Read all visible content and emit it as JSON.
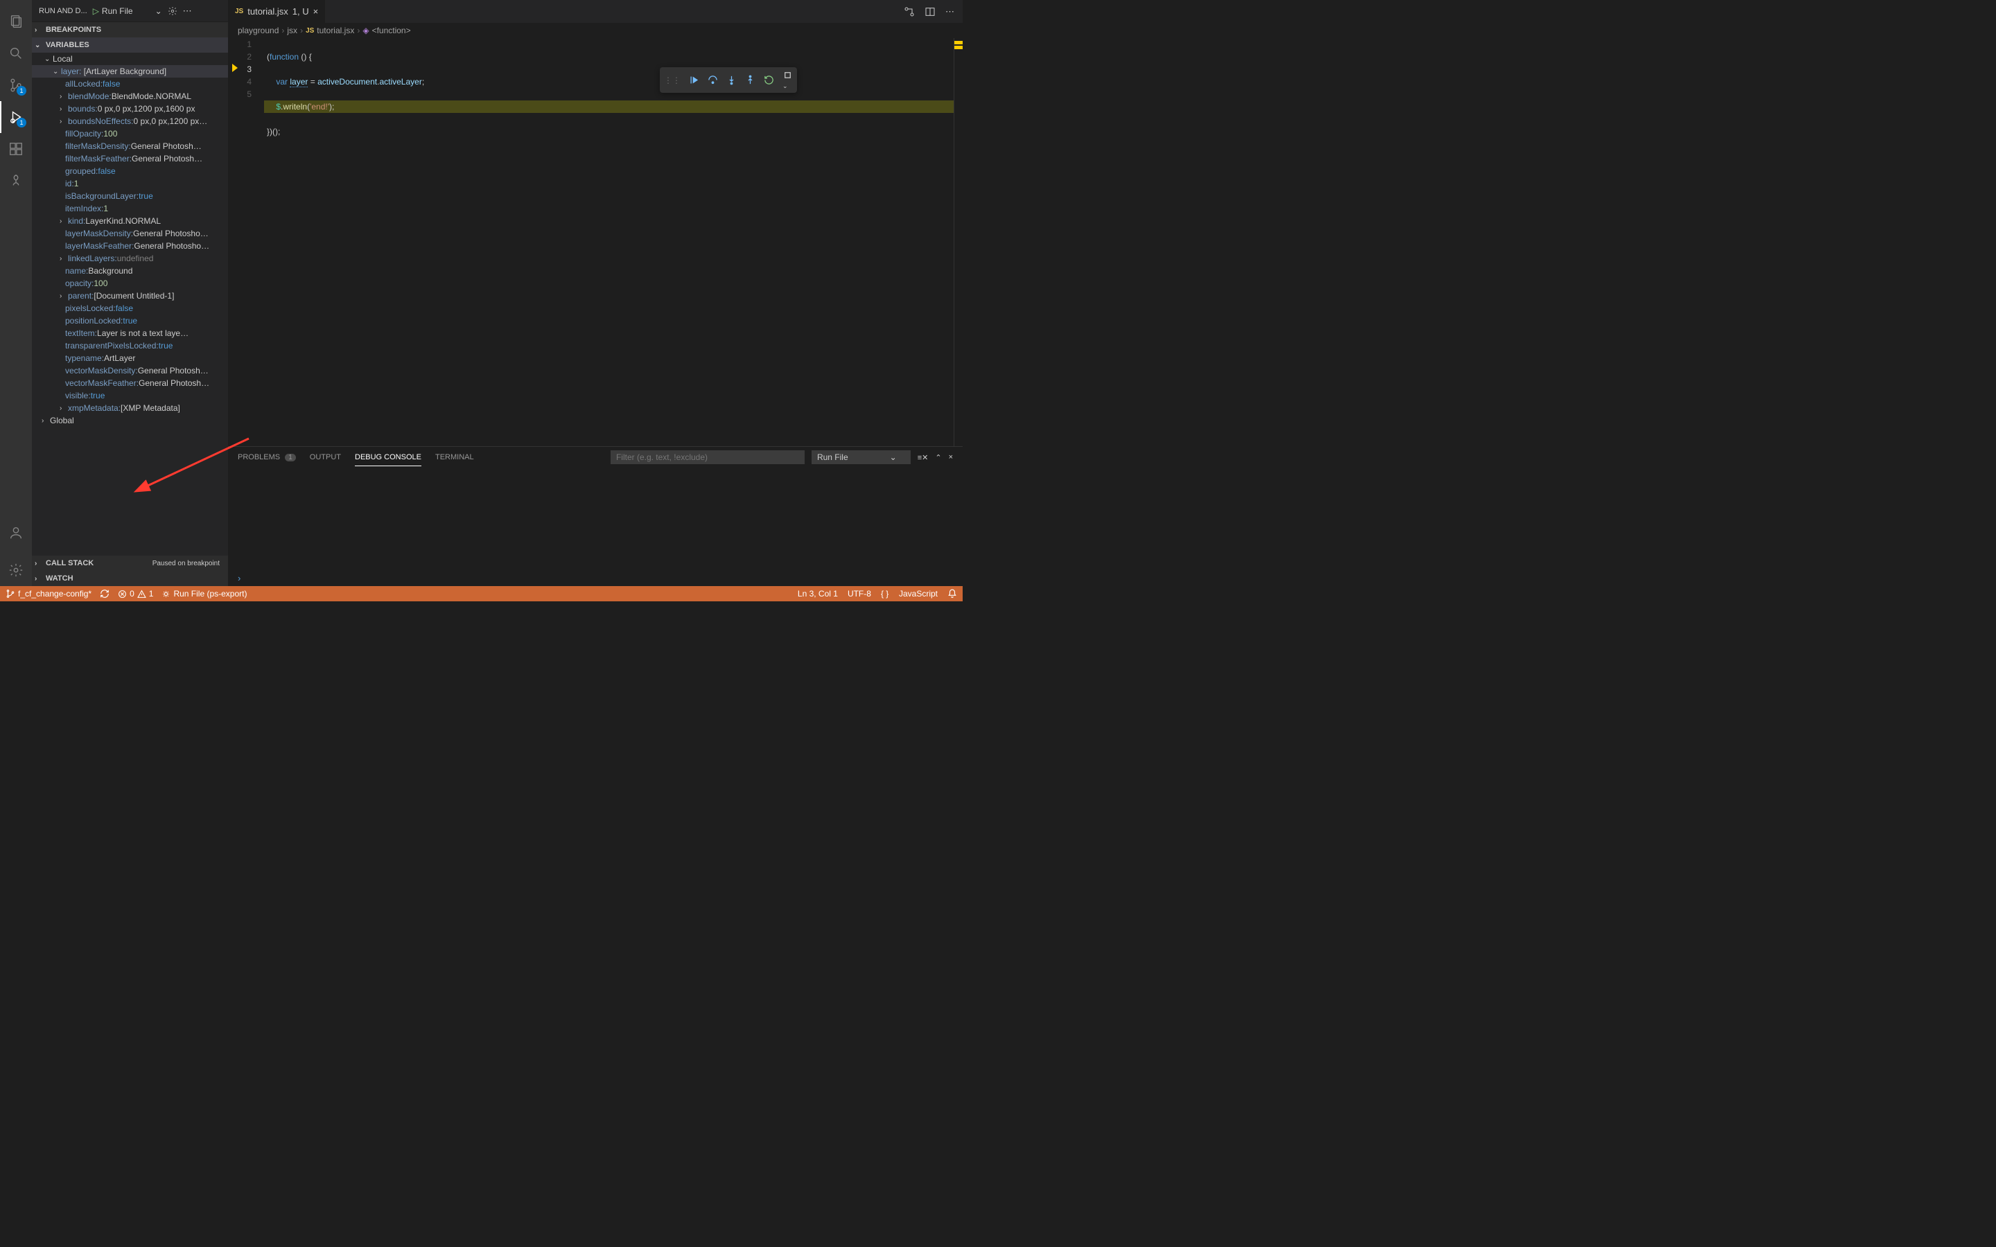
{
  "activity_bar": {
    "scm_badge": "1",
    "debug_badge": "1"
  },
  "sidebar": {
    "title": "RUN AND D...",
    "run_label": "Run File",
    "sections": {
      "breakpoints": "BREAKPOINTS",
      "variables": "VARIABLES",
      "call_stack": "CALL STACK",
      "call_stack_status": "Paused on breakpoint",
      "watch": "WATCH"
    },
    "scopes": {
      "local": "Local",
      "global": "Global"
    },
    "layer_label": "layer:",
    "layer_value": "[ArtLayer Background]",
    "props": [
      {
        "k": "allLocked",
        "v": "false",
        "t": "bool",
        "exp": false
      },
      {
        "k": "blendMode",
        "v": "BlendMode.NORMAL",
        "t": "plain",
        "exp": true
      },
      {
        "k": "bounds",
        "v": "0 px,0 px,1200 px,1600 px",
        "t": "plain",
        "exp": true
      },
      {
        "k": "boundsNoEffects",
        "v": "0 px,0 px,1200 px…",
        "t": "plain",
        "exp": true
      },
      {
        "k": "fillOpacity",
        "v": "100",
        "t": "num",
        "exp": false
      },
      {
        "k": "filterMaskDensity",
        "v": "General Photosh…",
        "t": "plain",
        "exp": false
      },
      {
        "k": "filterMaskFeather",
        "v": "General Photosh…",
        "t": "plain",
        "exp": false
      },
      {
        "k": "grouped",
        "v": "false",
        "t": "bool",
        "exp": false
      },
      {
        "k": "id",
        "v": "1",
        "t": "num",
        "exp": false
      },
      {
        "k": "isBackgroundLayer",
        "v": "true",
        "t": "bool",
        "exp": false
      },
      {
        "k": "itemIndex",
        "v": "1",
        "t": "num",
        "exp": false
      },
      {
        "k": "kind",
        "v": "LayerKind.NORMAL",
        "t": "plain",
        "exp": true
      },
      {
        "k": "layerMaskDensity",
        "v": "General Photosho…",
        "t": "plain",
        "exp": false
      },
      {
        "k": "layerMaskFeather",
        "v": "General Photosho…",
        "t": "plain",
        "exp": false
      },
      {
        "k": "linkedLayers",
        "v": "undefined",
        "t": "undef",
        "exp": true
      },
      {
        "k": "name",
        "v": "Background",
        "t": "plain",
        "exp": false
      },
      {
        "k": "opacity",
        "v": "100",
        "t": "num",
        "exp": false
      },
      {
        "k": "parent",
        "v": "[Document Untitled-1]",
        "t": "plain",
        "exp": true
      },
      {
        "k": "pixelsLocked",
        "v": "false",
        "t": "bool",
        "exp": false
      },
      {
        "k": "positionLocked",
        "v": "true",
        "t": "bool",
        "exp": false
      },
      {
        "k": "textItem",
        "v": "Layer is not a text laye…",
        "t": "plain",
        "exp": false
      },
      {
        "k": "transparentPixelsLocked",
        "v": "true",
        "t": "bool",
        "exp": false
      },
      {
        "k": "typename",
        "v": "ArtLayer",
        "t": "plain",
        "exp": false
      },
      {
        "k": "vectorMaskDensity",
        "v": "General Photosh…",
        "t": "plain",
        "exp": false
      },
      {
        "k": "vectorMaskFeather",
        "v": "General Photosh…",
        "t": "plain",
        "exp": false
      },
      {
        "k": "visible",
        "v": "true",
        "t": "bool",
        "exp": false
      },
      {
        "k": "xmpMetadata",
        "v": "[XMP Metadata]",
        "t": "plain",
        "exp": true
      }
    ]
  },
  "tabs": {
    "file_icon": "JS",
    "filename": "tutorial.jsx",
    "modified": "1, U"
  },
  "breadcrumb": {
    "p0": "playground",
    "p1": "jsx",
    "p2_icon": "JS",
    "p2": "tutorial.jsx",
    "p3": "<function>"
  },
  "editor": {
    "lines": [
      "1",
      "2",
      "3",
      "4",
      "5"
    ]
  },
  "panel": {
    "tabs": {
      "problems": "PROBLEMS",
      "problems_count": "1",
      "output": "OUTPUT",
      "debug_console": "DEBUG CONSOLE",
      "terminal": "TERMINAL"
    },
    "filter_placeholder": "Filter (e.g. text, !exclude)",
    "run_select": "Run File"
  },
  "status": {
    "branch": "f_cf_change-config*",
    "errors": "0",
    "warnings": "1",
    "task": "Run File (ps-export)",
    "cursor": "Ln 3, Col 1",
    "encoding": "UTF-8",
    "lang_icon": "{ }",
    "lang": "JavaScript"
  }
}
